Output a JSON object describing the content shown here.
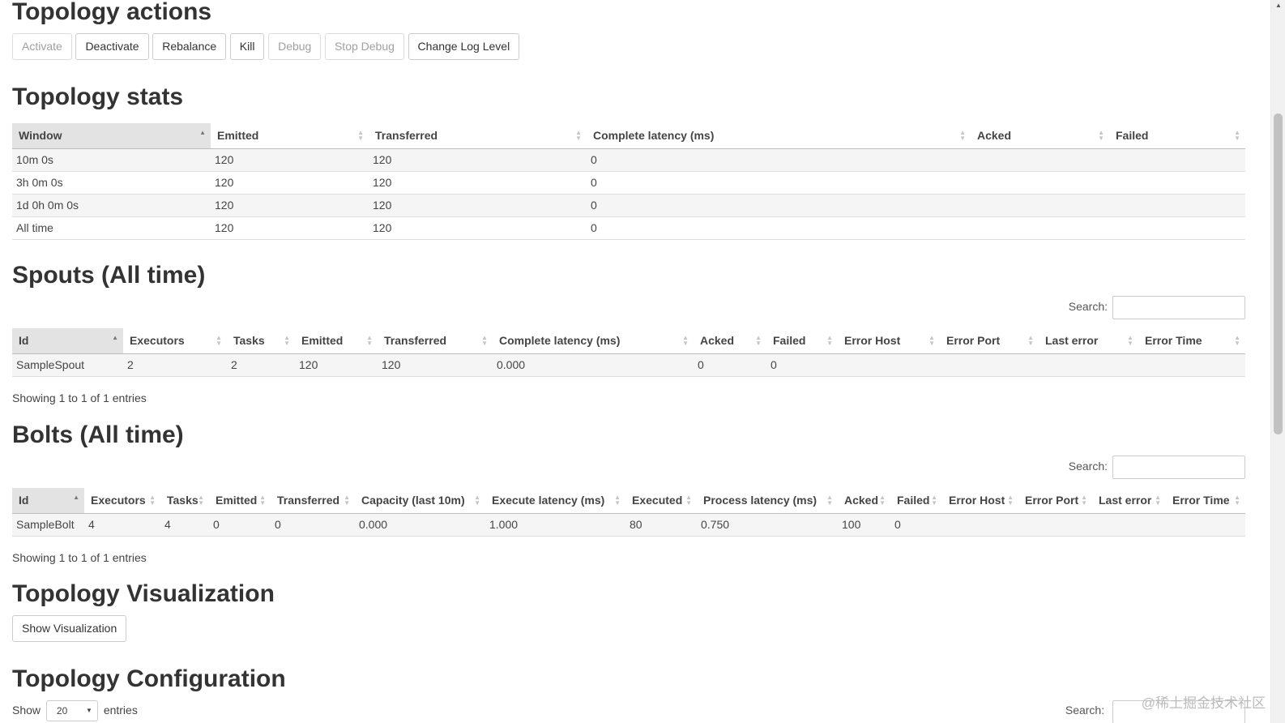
{
  "actions": {
    "title": "Topology actions",
    "buttons": {
      "activate": "Activate",
      "deactivate": "Deactivate",
      "rebalance": "Rebalance",
      "kill": "Kill",
      "debug": "Debug",
      "stop_debug": "Stop Debug",
      "change_log_level": "Change Log Level"
    }
  },
  "stats": {
    "title": "Topology stats",
    "headers": [
      "Window",
      "Emitted",
      "Transferred",
      "Complete latency (ms)",
      "Acked",
      "Failed"
    ],
    "rows": [
      [
        "10m 0s",
        "120",
        "120",
        "0",
        "",
        ""
      ],
      [
        "3h 0m 0s",
        "120",
        "120",
        "0",
        "",
        ""
      ],
      [
        "1d 0h 0m 0s",
        "120",
        "120",
        "0",
        "",
        ""
      ],
      [
        "All time",
        "120",
        "120",
        "0",
        "",
        ""
      ]
    ]
  },
  "spouts": {
    "title": "Spouts (All time)",
    "search_label": "Search:",
    "headers": [
      "Id",
      "Executors",
      "Tasks",
      "Emitted",
      "Transferred",
      "Complete latency (ms)",
      "Acked",
      "Failed",
      "Error Host",
      "Error Port",
      "Last error",
      "Error Time"
    ],
    "rows": [
      [
        "SampleSpout",
        "2",
        "2",
        "120",
        "120",
        "0.000",
        "0",
        "0",
        "",
        "",
        "",
        ""
      ]
    ],
    "info": "Showing 1 to 1 of 1 entries"
  },
  "bolts": {
    "title": "Bolts (All time)",
    "search_label": "Search:",
    "headers": [
      "Id",
      "Executors",
      "Tasks",
      "Emitted",
      "Transferred",
      "Capacity (last 10m)",
      "Execute latency (ms)",
      "Executed",
      "Process latency (ms)",
      "Acked",
      "Failed",
      "Error Host",
      "Error Port",
      "Last error",
      "Error Time"
    ],
    "rows": [
      [
        "SampleBolt",
        "4",
        "4",
        "0",
        "0",
        "0.000",
        "1.000",
        "80",
        "0.750",
        "100",
        "0",
        "",
        "",
        "",
        ""
      ]
    ],
    "info": "Showing 1 to 1 of 1 entries"
  },
  "visualization": {
    "title": "Topology Visualization",
    "button": "Show Visualization"
  },
  "configuration": {
    "title": "Topology Configuration",
    "show_label": "Show",
    "page_size": "20",
    "entries_label": "entries",
    "search_label": "Search:"
  },
  "watermark": "@稀土掘金技术社区"
}
